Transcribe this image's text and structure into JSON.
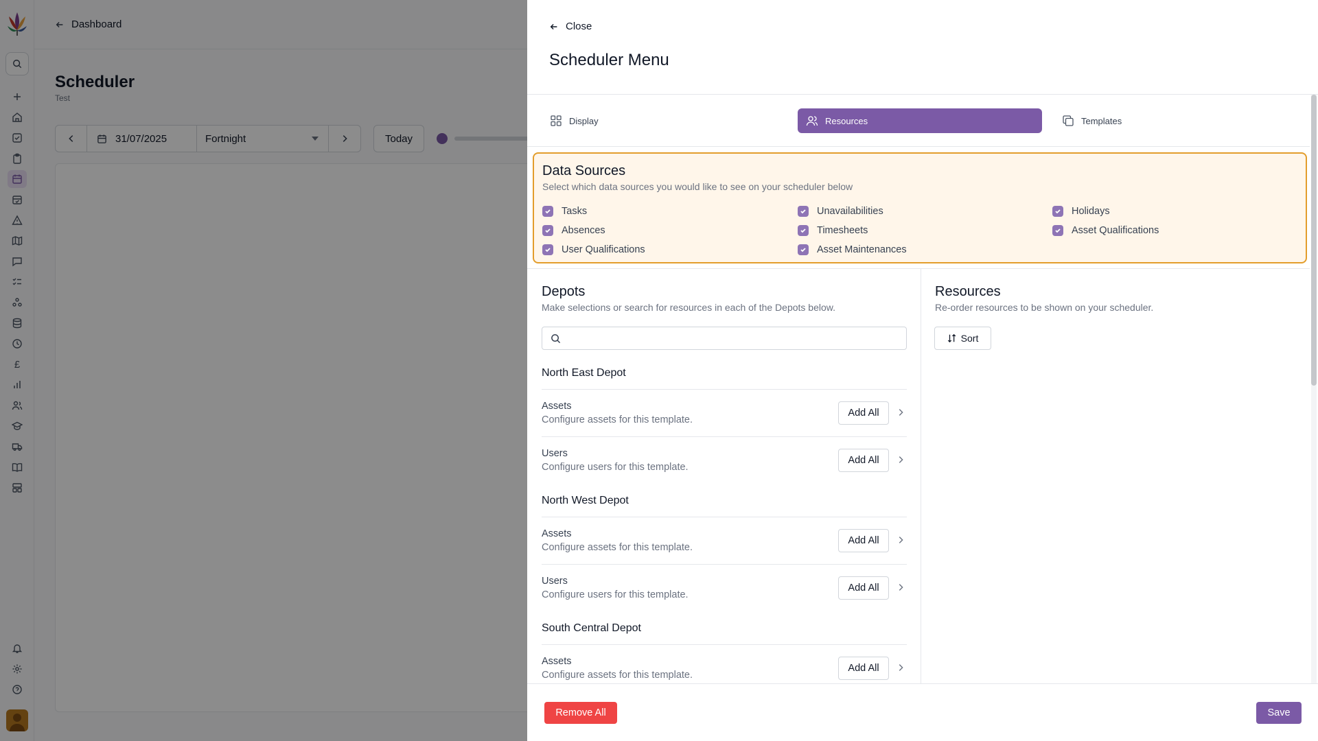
{
  "background": {
    "back_link": "Dashboard",
    "page_title": "Scheduler",
    "page_subtitle": "Test",
    "date_value": "31/07/2025",
    "range_value": "Fortnight",
    "today_label": "Today"
  },
  "drawer": {
    "close_label": "Close",
    "title": "Scheduler Menu",
    "tabs": [
      {
        "label": "Display",
        "icon": "grid-icon",
        "active": false
      },
      {
        "label": "Resources",
        "icon": "users-icon",
        "active": true
      },
      {
        "label": "Templates",
        "icon": "copy-icon",
        "active": false
      }
    ],
    "data_sources": {
      "title": "Data Sources",
      "subtitle": "Select which data sources you would like to see on your scheduler below",
      "items": [
        {
          "label": "Tasks",
          "checked": true
        },
        {
          "label": "Unavailabilities",
          "checked": true
        },
        {
          "label": "Holidays",
          "checked": true
        },
        {
          "label": "Absences",
          "checked": true
        },
        {
          "label": "Timesheets",
          "checked": true
        },
        {
          "label": "Asset Qualifications",
          "checked": true
        },
        {
          "label": "User Qualifications",
          "checked": true
        },
        {
          "label": "Asset Maintenances",
          "checked": true
        }
      ]
    },
    "depots": {
      "title": "Depots",
      "subtitle": "Make selections or search for resources in each of the Depots below.",
      "search_placeholder": "",
      "add_all_label": "Add All",
      "list": [
        {
          "name": "North East Depot",
          "rows": [
            {
              "label": "Assets",
              "desc": "Configure assets for this template."
            },
            {
              "label": "Users",
              "desc": "Configure users for this template."
            }
          ]
        },
        {
          "name": "North West Depot",
          "rows": [
            {
              "label": "Assets",
              "desc": "Configure assets for this template."
            },
            {
              "label": "Users",
              "desc": "Configure users for this template."
            }
          ]
        },
        {
          "name": "South Central Depot",
          "rows": [
            {
              "label": "Assets",
              "desc": "Configure assets for this template."
            }
          ]
        }
      ]
    },
    "resources": {
      "title": "Resources",
      "subtitle": "Re-order resources to be shown on your scheduler.",
      "sort_label": "Sort"
    },
    "footer": {
      "remove_all_label": "Remove All",
      "save_label": "Save"
    }
  },
  "colors": {
    "accent": "#7b5aa6",
    "danger": "#ef4444",
    "highlight_border": "#e39d2b",
    "highlight_bg": "#fff6ea"
  }
}
